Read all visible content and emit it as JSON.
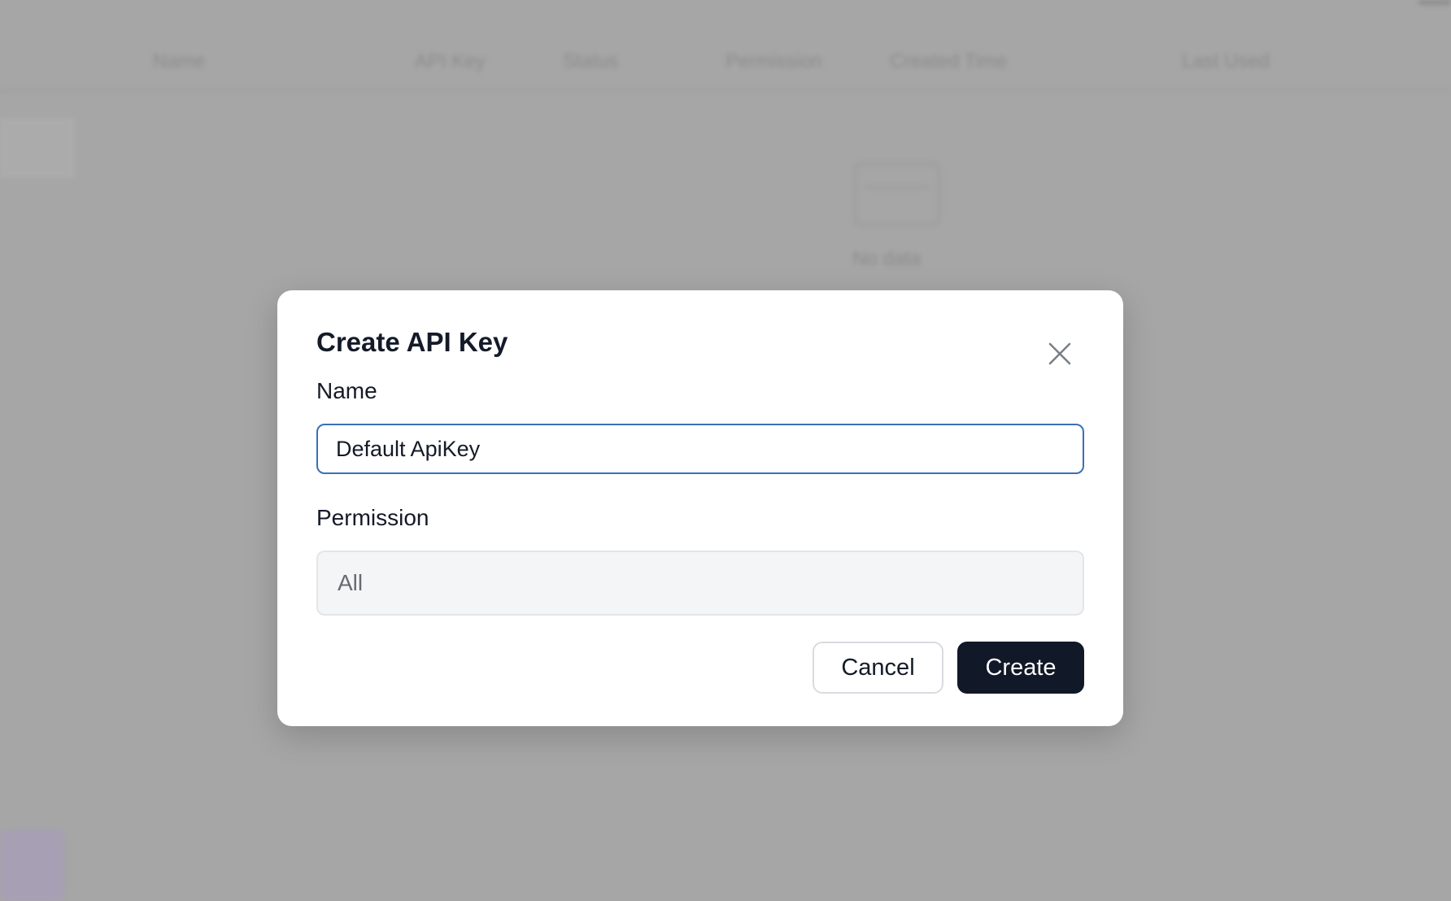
{
  "background": {
    "table_columns": [
      "Name",
      "API Key",
      "Status",
      "Permission",
      "Created Time",
      "Last Used"
    ],
    "empty_text": "No data",
    "overlay_color": "#a6a6a6"
  },
  "dialog": {
    "title": "Create API Key",
    "close_icon": "close-icon",
    "name_field": {
      "label": "Name",
      "value": "Default ApiKey"
    },
    "permission_field": {
      "label": "Permission",
      "value": "All"
    },
    "cancel_label": "Cancel",
    "create_label": "Create",
    "colors": {
      "primary": "#111827",
      "focus_border": "#3a6fb8"
    }
  }
}
